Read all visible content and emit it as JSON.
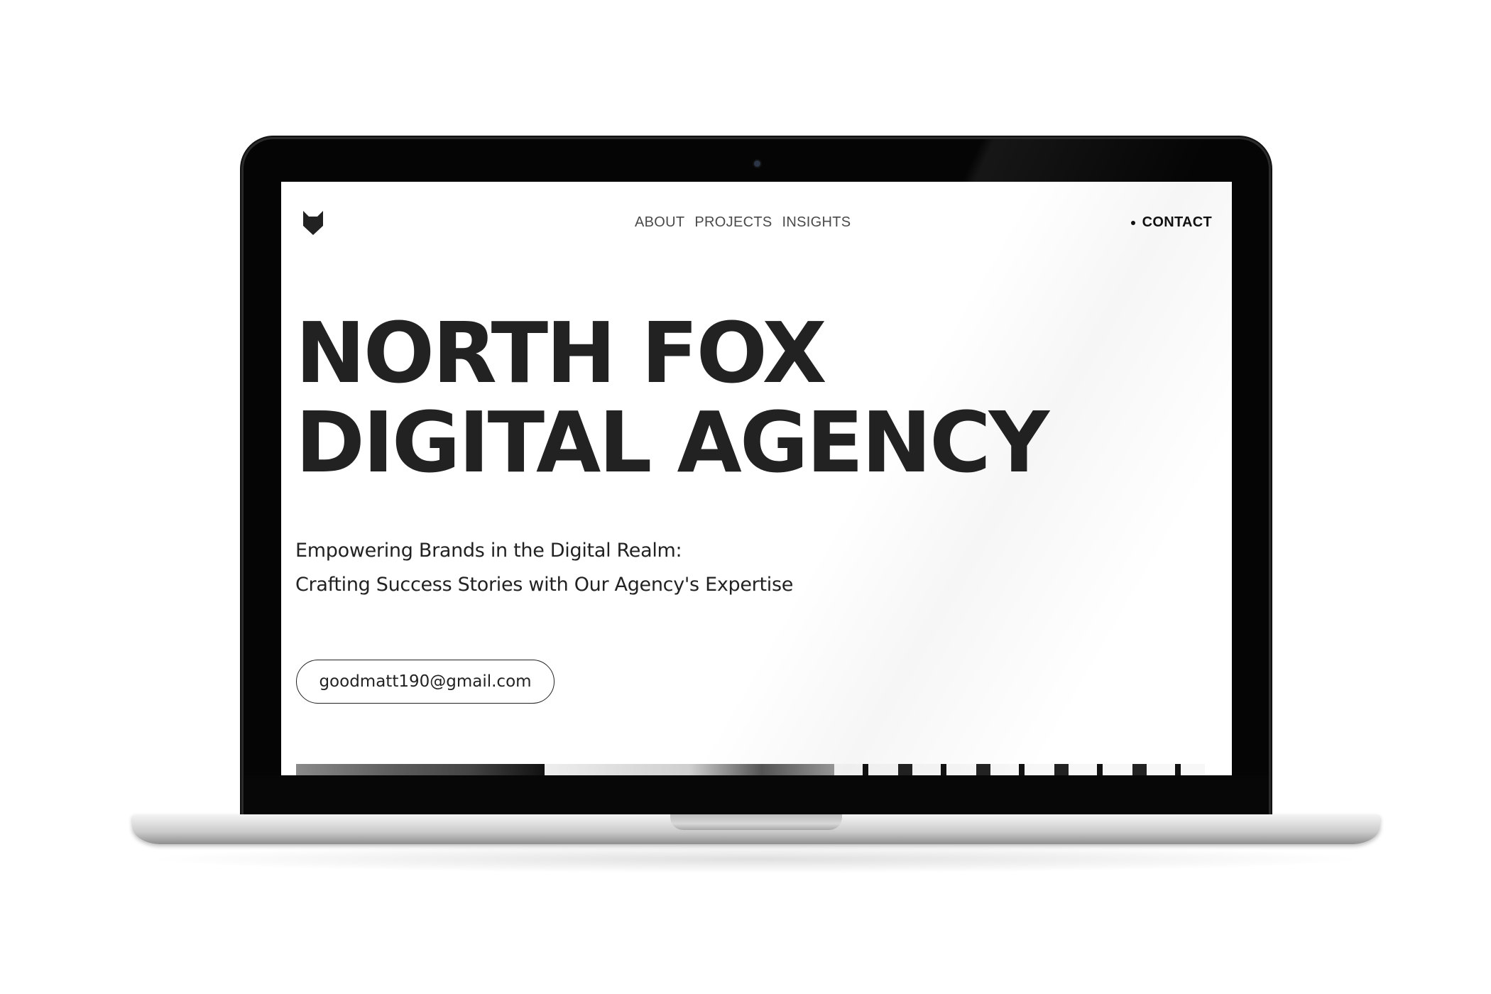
{
  "site": {
    "logo_icon": "fox-head-icon",
    "nav": [
      {
        "label": "ABOUT"
      },
      {
        "label": "PROJECTS"
      },
      {
        "label": "INSIGHTS"
      }
    ],
    "contact_label": "CONTACT"
  },
  "hero": {
    "title_line1": "NORTH FOX",
    "title_line2": "DIGITAL AGENCY",
    "subtitle_line1": "Empowering Brands in the Digital Realm:",
    "subtitle_line2": "Crafting Success Stories with Our Agency's Expertise",
    "email": "goodmatt190@gmail.com"
  },
  "colors": {
    "text_dark": "#222222",
    "nav_text": "#4a4a4a",
    "bezel": "#050505",
    "base": "#dcdcdc"
  }
}
